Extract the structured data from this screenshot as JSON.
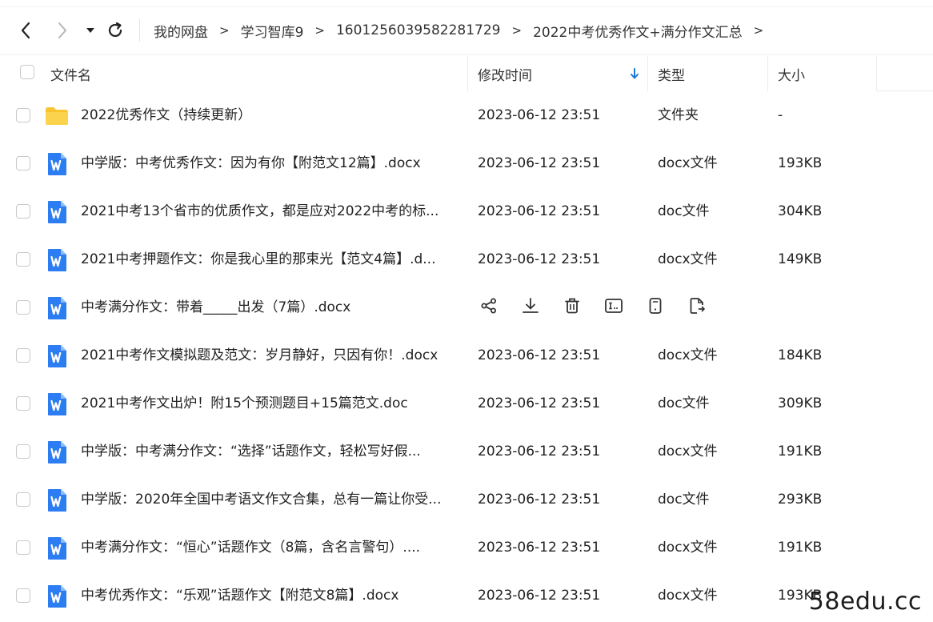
{
  "nav": {
    "breadcrumbs": [
      "我的网盘",
      "学习智库9",
      "1601256039582281729",
      "2022中考优秀作文+满分作文汇总"
    ],
    "separator": ">"
  },
  "table": {
    "headers": {
      "name": "文件名",
      "modified": "修改时间",
      "type": "类型",
      "size": "大小"
    },
    "sort_column": "modified",
    "sort_direction": "descending",
    "rows": [
      {
        "icon": "folder-icon",
        "name": "2022优秀作文（持续更新）",
        "modified": "2023-06-12 23:51",
        "type": "文件夹",
        "size": "-"
      },
      {
        "icon": "word-doc-icon",
        "name": "中学版：中考优秀作文：因为有你【附范文12篇】.docx",
        "modified": "2023-06-12 23:51",
        "type": "docx文件",
        "size": "193KB"
      },
      {
        "icon": "word-doc-icon",
        "name": "2021中考13个省市的优质作文，都是应对2022中考的标...",
        "modified": "2023-06-12 23:51",
        "type": "doc文件",
        "size": "304KB"
      },
      {
        "icon": "word-doc-icon",
        "name": "2021中考押题作文：你是我心里的那束光【范文4篇】.d...",
        "modified": "2023-06-12 23:51",
        "type": "docx文件",
        "size": "149KB"
      },
      {
        "icon": "word-doc-icon",
        "name": "中考满分作文：带着_____出发（7篇）.docx",
        "hovered": true
      },
      {
        "icon": "word-doc-icon",
        "name": "2021中考作文模拟题及范文：岁月静好，只因有你！.docx",
        "modified": "2023-06-12 23:51",
        "type": "docx文件",
        "size": "184KB"
      },
      {
        "icon": "word-doc-icon",
        "name": "2021中考作文出炉！附15个预测题目+15篇范文.doc",
        "modified": "2023-06-12 23:51",
        "type": "doc文件",
        "size": "309KB"
      },
      {
        "icon": "word-doc-icon",
        "name": "中学版：中考满分作文：“选择”话题作文，轻松写好假...",
        "modified": "2023-06-12 23:51",
        "type": "docx文件",
        "size": "191KB"
      },
      {
        "icon": "word-doc-icon",
        "name": "中学版：2020年全国中考语文作文合集，总有一篇让你受...",
        "modified": "2023-06-12 23:51",
        "type": "doc文件",
        "size": "293KB"
      },
      {
        "icon": "word-doc-icon",
        "name": "中考满分作文：“恒心”话题作文（8篇，含名言警句）....",
        "modified": "2023-06-12 23:51",
        "type": "docx文件",
        "size": "191KB"
      },
      {
        "icon": "word-doc-icon",
        "name": "中考优秀作文：“乐观”话题作文【附范文8篇】.docx",
        "modified": "2023-06-12 23:51",
        "type": "docx文件",
        "size": "193KB"
      }
    ]
  },
  "hover_actions": [
    "share-icon",
    "download-icon",
    "delete-icon",
    "rename-icon",
    "mobile-icon",
    "move-icon"
  ],
  "watermark": "58edu.cc",
  "colors": {
    "accent": "#1e7ad8",
    "folder": "#f8c531",
    "word": "#2c7cf2"
  }
}
